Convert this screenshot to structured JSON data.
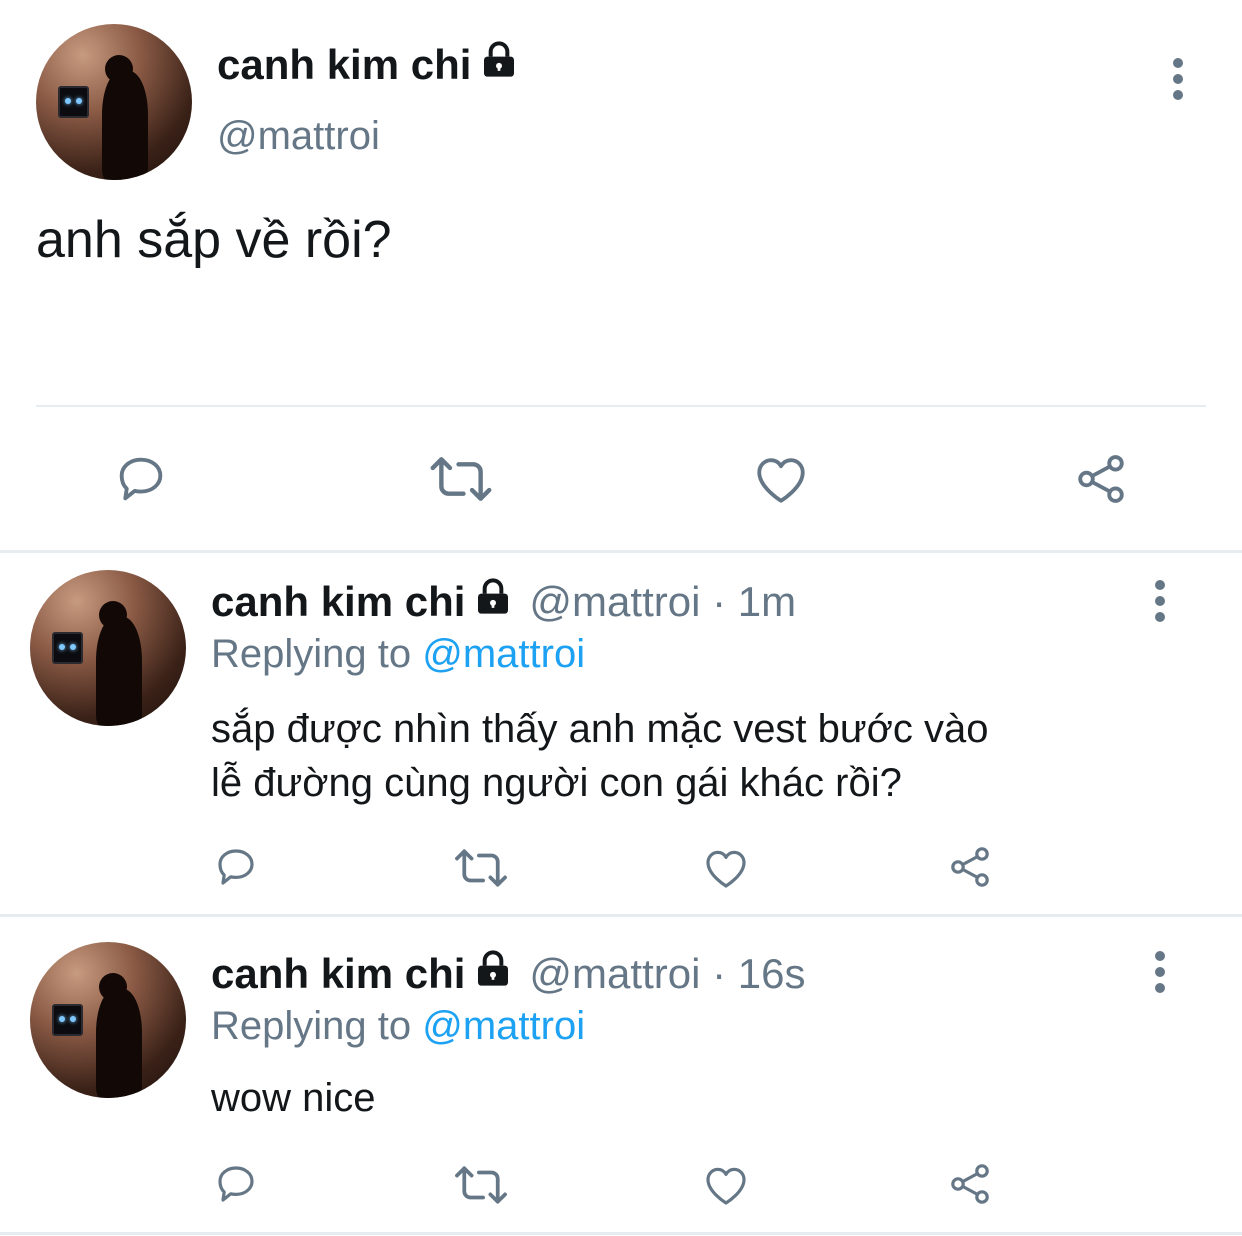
{
  "main_tweet": {
    "display_name": "canh kim chi",
    "handle": "@mattroi",
    "text": "anh sắp về rồi?"
  },
  "replies": [
    {
      "display_name": "canh kim chi",
      "handle": "@mattroi",
      "separator": "·",
      "time": "1m",
      "replying_label": "Replying to",
      "replying_to": "@mattroi",
      "text_line1": "sắp được nhìn thấy anh mặc vest bước vào",
      "text_line2": "lễ đường cùng người con gái khác rồi?"
    },
    {
      "display_name": "canh kim chi",
      "handle": "@mattroi",
      "separator": "·",
      "time": "16s",
      "replying_label": "Replying to",
      "replying_to": "@mattroi",
      "text_line1": "wow nice"
    }
  ],
  "icons": {
    "reply": "reply-icon",
    "retweet": "retweet-icon",
    "like": "like-icon",
    "share": "share-icon",
    "lock": "lock-icon",
    "more": "more-icon"
  },
  "colors": {
    "link": "#1da1f2",
    "secondary_text": "#657786",
    "divider": "#e6ecf0"
  }
}
